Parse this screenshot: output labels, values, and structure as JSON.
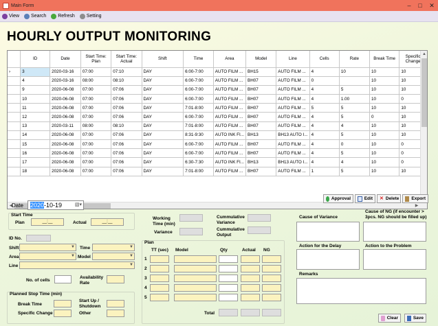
{
  "window": {
    "title": "Main Form"
  },
  "menu": [
    {
      "label": "View",
      "color": "#7b3fa0"
    },
    {
      "label": "Search",
      "color": "#5b7fb8"
    },
    {
      "label": "Refresh",
      "color": "#4aa83c"
    },
    {
      "label": "Setting",
      "color": "#8d8d8d"
    }
  ],
  "heading": "HOURLY OUTPUT MONITORING",
  "grid": {
    "columns": [
      "ID",
      "Date",
      "Start Time: Plan",
      "Start Time: Actual",
      "Shift",
      "Time",
      "Area",
      "Model",
      "Line",
      "Cells",
      "Rate",
      "Break Time",
      "Specific Change"
    ],
    "rows": [
      [
        "3",
        "2020-03-16",
        "07:00",
        "07:10",
        "DAY",
        "6:00-7:00",
        "AUTO FILM ...",
        "BH15",
        "AUTO FILM ...",
        "4",
        "10",
        "10",
        "10"
      ],
      [
        "4",
        "2020-03-16",
        "08:00",
        "08:10",
        "DAY",
        "6:00-7:00",
        "AUTO FILM ...",
        "BH07",
        "AUTO FILM ...",
        "0",
        "",
        "10",
        "10"
      ],
      [
        "9",
        "2020-06-08",
        "07:00",
        "07:06",
        "DAY",
        "6:00-7:00",
        "AUTO FILM ...",
        "BH07",
        "AUTO FILM ...",
        "4",
        "5",
        "10",
        "10"
      ],
      [
        "10",
        "2020-06-08",
        "07:00",
        "07:06",
        "DAY",
        "6:00-7:00",
        "AUTO FILM ...",
        "BH07",
        "AUTO FILM ...",
        "4",
        "1.00",
        "10",
        "0"
      ],
      [
        "11",
        "2020-06-08",
        "07:00",
        "07:06",
        "DAY",
        "7:01-8:00",
        "AUTO FILM ...",
        "BH07",
        "AUTO FILM ...",
        "5",
        "5",
        "10",
        "10"
      ],
      [
        "12",
        "2020-06-08",
        "07:00",
        "07:06",
        "DAY",
        "6:00-7:00",
        "AUTO FILM ...",
        "BH07",
        "AUTO FILM ...",
        "4",
        "5",
        "0",
        "10"
      ],
      [
        "13",
        "2020-03-11",
        "08:00",
        "08:10",
        "DAY",
        "7:01-8:00",
        "AUTO FILM ...",
        "BH07",
        "AUTO FILM ...",
        "4",
        "4",
        "10",
        "10"
      ],
      [
        "14",
        "2020-06-08",
        "07:00",
        "07:06",
        "DAY",
        "8:31-9:30",
        "AUTO INK FI...",
        "BH13",
        "BH13 AUTO I...",
        "4",
        "5",
        "10",
        "10"
      ],
      [
        "15",
        "2020-06-08",
        "07:00",
        "07:06",
        "DAY",
        "6:00-7:00",
        "AUTO FILM ...",
        "BH07",
        "AUTO FILM ...",
        "4",
        "0",
        "10",
        "0"
      ],
      [
        "16",
        "2020-06-08",
        "07:00",
        "07:06",
        "DAY",
        "6:00-7:00",
        "AUTO FILM ...",
        "BH07",
        "AUTO FILM ...",
        "4",
        "5",
        "10",
        "0"
      ],
      [
        "17",
        "2020-06-08",
        "07:00",
        "07:06",
        "DAY",
        "6:30-7:30",
        "AUTO INK FI...",
        "BH13",
        "BH13 AUTO I...",
        "4",
        "4",
        "10",
        "0"
      ],
      [
        "18",
        "2020-06-08",
        "07:00",
        "07:06",
        "DAY",
        "7:01-8:00",
        "AUTO FILM ...",
        "BH07",
        "AUTO FILM ...",
        "1",
        "5",
        "10",
        "10"
      ]
    ],
    "selected_row_marker": "›"
  },
  "buttons": {
    "approval": "Approval",
    "edit": "Edit",
    "delete": "Delete",
    "export": "Export",
    "clear": "Clear",
    "save": "Save"
  },
  "form": {
    "date_label": "Date",
    "date_year": "2020",
    "date_rest": "-10-19",
    "start_time_title": "Start Time",
    "plan_label": "Plan",
    "actual_label": "Actual",
    "time_placeholder": "__:__",
    "id_no_label": "ID No.",
    "shift_label": "Shift",
    "time_label": "Time",
    "area_label": "Area",
    "model_label": "Model",
    "line_label": "Line",
    "cells_label": "No. of cells",
    "availability_label": "Availability Rate",
    "planned_stop_title": "Planned Stop Time (min)",
    "break_label": "Break Time",
    "startup_label": "Start Up / Shutdown",
    "specific_label": "Specific Change",
    "other_label": "Other",
    "working_time_label": "Working Time (min)",
    "variance_label": "Variance",
    "cum_variance_label": "Cummulative Variance",
    "cum_output_label": "Cummulative Output",
    "plan_title": "Plan",
    "plan_headers": [
      "TT (sec)",
      "Model",
      "Qty",
      "Actual",
      "NG"
    ],
    "plan_rows": [
      "1",
      "2",
      "3",
      "4",
      "5"
    ],
    "total_label": "Total",
    "cause_variance_label": "Cause of Variance",
    "cause_ng_label": "Cause of NG (if encounter > 3pcs. NG should be filled up)",
    "action_delay_label": "Action for the Delay",
    "action_problem_label": "Action to the Problem",
    "remarks_label": "Remarks"
  }
}
